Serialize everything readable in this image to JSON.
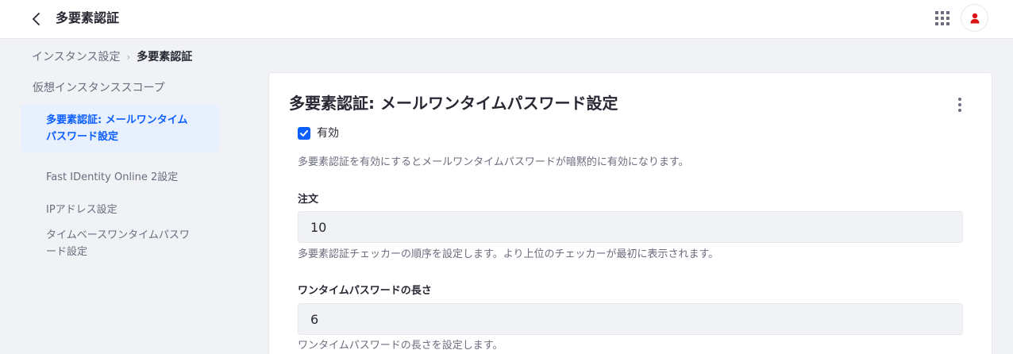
{
  "header": {
    "title": "多要素認証",
    "back_icon": "chevron-left-icon",
    "apps_icon": "apps-grid-icon",
    "avatar_icon": "user-icon",
    "avatar_color": "#da1414"
  },
  "breadcrumb": {
    "parent": "インスタンス設定",
    "separator": "›",
    "current": "多要素認証"
  },
  "sidebar": {
    "heading": "仮想インスタンススコープ",
    "items": [
      {
        "label": "多要素認証: メールワンタイムパスワード設定",
        "active": true
      },
      {
        "label": "Fast IDentity Online 2設定",
        "active": false
      },
      {
        "label": "IPアドレス設定",
        "active": false
      },
      {
        "label": "タイムベースワンタイムパスワード設定",
        "active": false
      }
    ]
  },
  "main": {
    "title": "多要素認証: メールワンタイムパスワード設定",
    "enabled": {
      "label": "有効",
      "checked": true
    },
    "enabled_help": "多要素認証を有効にするとメールワンタイムパスワードが暗黙的に有効になります。",
    "order": {
      "label": "注文",
      "value": "10",
      "help": "多要素認証チェッカーの順序を設定します。より上位のチェッカーが最初に表示されます。"
    },
    "otp_length": {
      "label": "ワンタイムパスワードの長さ",
      "value": "6",
      "help": "ワンタイムパスワードの長さを設定します。"
    }
  },
  "colors": {
    "accent": "#0b5fff",
    "active_bg": "#e9f0fd",
    "page_bg": "#f1f2f5"
  }
}
